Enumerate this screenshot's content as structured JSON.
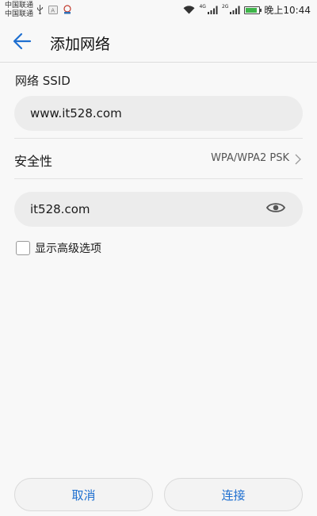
{
  "status_bar": {
    "carrier_1": "中国联通",
    "carrier_2": "中国联通",
    "net_label_1": "4G",
    "net_label_2": "2G",
    "time": "晚上10:44",
    "battery_level": 0.85,
    "battery_color": "#3fb54a"
  },
  "app_bar": {
    "title": "添加网络",
    "back_icon": "arrow-left-icon",
    "accent_color": "#1e6fd0"
  },
  "form": {
    "ssid_label": "网络 SSID",
    "ssid_value": "www.it528.com",
    "security_label": "安全性",
    "security_value": "WPA/WPA2 PSK",
    "password_value": "it528.com",
    "password_visibility_icon": "eye-icon",
    "advanced_options_label": "显示高级选项",
    "advanced_options_checked": false
  },
  "actions": {
    "cancel_label": "取消",
    "connect_label": "连接"
  }
}
